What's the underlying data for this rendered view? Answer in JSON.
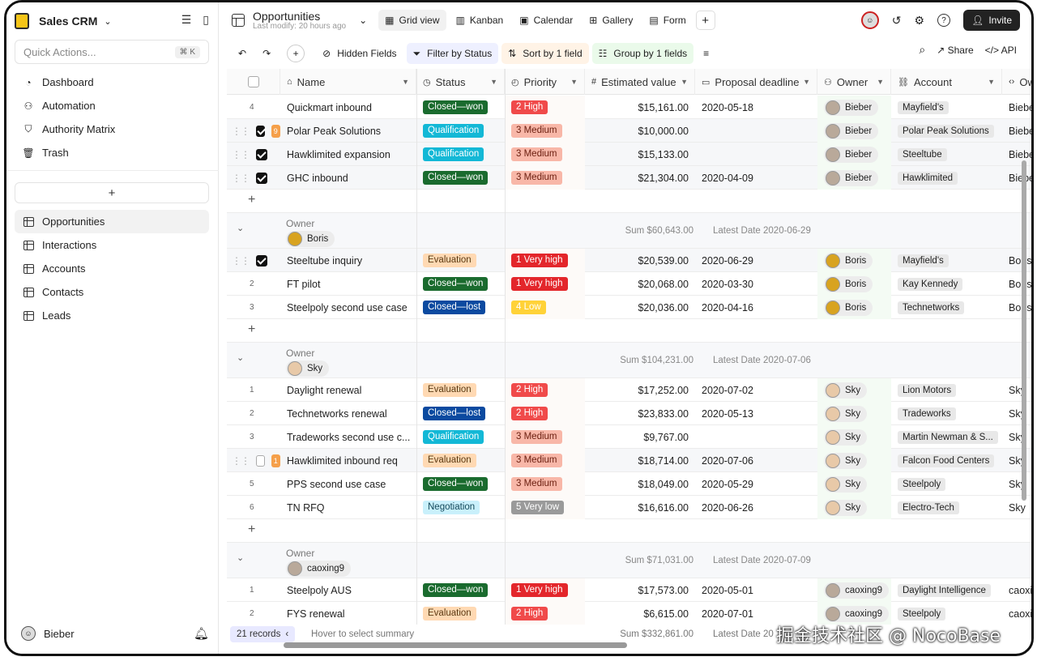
{
  "sidebar": {
    "title": "Sales CRM",
    "quick_actions": "Quick Actions...",
    "quick_kbd": "⌘ K",
    "nav": [
      {
        "label": "Dashboard",
        "icon": "dashboard-icon"
      },
      {
        "label": "Automation",
        "icon": "automation-icon"
      },
      {
        "label": "Authority Matrix",
        "icon": "shield-icon"
      },
      {
        "label": "Trash",
        "icon": "trash-icon"
      }
    ],
    "add": "+",
    "tables": [
      {
        "label": "Opportunities",
        "active": true
      },
      {
        "label": "Interactions",
        "active": false
      },
      {
        "label": "Accounts",
        "active": false
      },
      {
        "label": "Contacts",
        "active": false
      },
      {
        "label": "Leads",
        "active": false
      }
    ],
    "user": "Bieber"
  },
  "header": {
    "title": "Opportunities",
    "subtitle": "Last modify: 20 hours ago",
    "views": [
      "Grid view",
      "Kanban",
      "Calendar",
      "Gallery",
      "Form"
    ],
    "invite": "Invite"
  },
  "toolbar": {
    "hidden": "Hidden Fields",
    "filter": "Filter by Status",
    "sort": "Sort by 1 field",
    "group": "Group by 1 fields",
    "share": "Share",
    "api": "API"
  },
  "columns": [
    "Name",
    "Status",
    "Priority",
    "Estimated value",
    "Proposal deadline",
    "Owner",
    "Account",
    "Ow"
  ],
  "status_colors": {
    "Closed—won": [
      "#1a6b2e",
      "#ffffff"
    ],
    "Closed—lost": [
      "#0b4aa0",
      "#ffffff"
    ],
    "Qualification": [
      "#13b8d6",
      "#ffffff"
    ],
    "Evaluation": [
      "#ffd9b3",
      "#5a3a13"
    ],
    "Negotiation": [
      "#c9f0fb",
      "#14495a"
    ]
  },
  "priority_colors": {
    "1 Very high": [
      "#e3262b",
      "#ffffff"
    ],
    "2 High": [
      "#f04a4a",
      "#ffffff"
    ],
    "3 Medium": [
      "#f8b7a8",
      "#6a1e0f"
    ],
    "4 Low": [
      "#ffd238",
      "#ffffff"
    ],
    "5 Very low": [
      "#9a9a9a",
      "#ffffff"
    ]
  },
  "top_rows": [
    {
      "n": "4",
      "name": "Quickmart inbound",
      "status": "Closed—won",
      "priority": "2 High",
      "value": "$15,161.00",
      "date": "2020-05-18",
      "owner": "Bieber",
      "account": "Mayfield's",
      "ow": "Biebe"
    },
    {
      "n": "",
      "badge": "9",
      "checked": true,
      "name": "Polar Peak Solutions",
      "status": "Qualification",
      "priority": "3 Medium",
      "value": "$10,000.00",
      "date": "",
      "owner": "Bieber",
      "account": "Polar Peak Solutions",
      "ow": "Biebe"
    },
    {
      "n": "",
      "checked": true,
      "name": "Hawklimited expansion",
      "status": "Qualification",
      "priority": "3 Medium",
      "value": "$15,133.00",
      "date": "",
      "owner": "Bieber",
      "account": "Steeltube",
      "ow": "Biebe"
    },
    {
      "n": "",
      "checked": true,
      "name": "GHC inbound",
      "status": "Closed—won",
      "priority": "3 Medium",
      "value": "$21,304.00",
      "date": "2020-04-09",
      "owner": "Bieber",
      "account": "Hawklimited",
      "ow": "Biebe"
    }
  ],
  "groups": [
    {
      "label": "Owner",
      "owner": "Boris",
      "sum": "Sum $60,643.00",
      "latest": "Latest Date 2020-06-29",
      "rows": [
        {
          "n": "",
          "checked": true,
          "name": "Steeltube inquiry",
          "status": "Evaluation",
          "priority": "1 Very high",
          "value": "$20,539.00",
          "date": "2020-06-29",
          "owner": "Boris",
          "account": "Mayfield's",
          "ow": "Boris"
        },
        {
          "n": "2",
          "name": "FT pilot",
          "status": "Closed—won",
          "priority": "1 Very high",
          "value": "$20,068.00",
          "date": "2020-03-30",
          "owner": "Boris",
          "account": "Kay Kennedy",
          "ow": "Boris"
        },
        {
          "n": "3",
          "name": "Steelpoly second use case",
          "status": "Closed—lost",
          "priority": "4 Low",
          "value": "$20,036.00",
          "date": "2020-04-16",
          "owner": "Boris",
          "account": "Technetworks",
          "ow": "Boris"
        }
      ]
    },
    {
      "label": "Owner",
      "owner": "Sky",
      "sum": "Sum $104,231.00",
      "latest": "Latest Date 2020-07-06",
      "rows": [
        {
          "n": "1",
          "name": "Daylight renewal",
          "status": "Evaluation",
          "priority": "2 High",
          "value": "$17,252.00",
          "date": "2020-07-02",
          "owner": "Sky",
          "account": "Lion Motors",
          "ow": "Sky"
        },
        {
          "n": "2",
          "name": "Technetworks renewal",
          "status": "Closed—lost",
          "priority": "2 High",
          "value": "$23,833.00",
          "date": "2020-05-13",
          "owner": "Sky",
          "account": "Tradeworks",
          "ow": "Sky"
        },
        {
          "n": "3",
          "name": "Tradeworks second use c...",
          "status": "Qualification",
          "priority": "3 Medium",
          "value": "$9,767.00",
          "date": "",
          "owner": "Sky",
          "account": "Martin Newman & S...",
          "ow": "Sky"
        },
        {
          "n": "",
          "badge": "1",
          "checked": false,
          "name": "Hawklimited inbound req",
          "status": "Evaluation",
          "priority": "3 Medium",
          "value": "$18,714.00",
          "date": "2020-07-06",
          "owner": "Sky",
          "account": "Falcon Food Centers",
          "ow": "Sky"
        },
        {
          "n": "5",
          "name": "PPS second use case",
          "status": "Closed—won",
          "priority": "3 Medium",
          "value": "$18,049.00",
          "date": "2020-05-29",
          "owner": "Sky",
          "account": "Steelpoly",
          "ow": "Sky"
        },
        {
          "n": "6",
          "name": "TN RFQ",
          "status": "Negotiation",
          "priority": "5 Very low",
          "value": "$16,616.00",
          "date": "2020-06-26",
          "owner": "Sky",
          "account": "Electro-Tech",
          "ow": "Sky"
        }
      ]
    },
    {
      "label": "Owner",
      "owner": "caoxing9",
      "sum": "Sum $71,031.00",
      "latest": "Latest Date 2020-07-09",
      "rows": [
        {
          "n": "1",
          "name": "Steelpoly AUS",
          "status": "Closed—won",
          "priority": "1 Very high",
          "value": "$17,573.00",
          "date": "2020-05-01",
          "owner": "caoxing9",
          "account": "Daylight Intelligence",
          "ow": "caoxi"
        },
        {
          "n": "2",
          "name": "FYS renewal",
          "status": "Evaluation",
          "priority": "2 High",
          "value": "$6,615.00",
          "date": "2020-07-01",
          "owner": "caoxing9",
          "account": "Steelpoly",
          "ow": "caoxi"
        }
      ]
    }
  ],
  "footer": {
    "records": "21 records",
    "hover": "Hover to select summary",
    "sum": "Sum $332,861.00",
    "latest": "Latest Date 20"
  },
  "watermark": "掘金技术社区 @ NocoBase"
}
